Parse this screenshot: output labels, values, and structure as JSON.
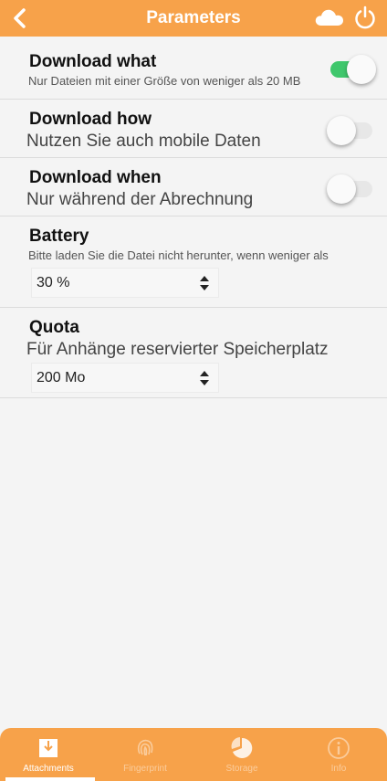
{
  "header": {
    "title": "Parameters",
    "back_icon": "chevron-left-icon",
    "cloud_icon": "cloud-icon",
    "power_icon": "power-icon",
    "color": "#f7a24a"
  },
  "settings": {
    "download_what": {
      "title": "Download what",
      "subtitle": "Nur Dateien mit einer Größe von weniger als 20 MB",
      "enabled": true
    },
    "download_how": {
      "title": "Download how",
      "subtitle": "Nutzen Sie auch mobile Daten",
      "enabled": false
    },
    "download_when": {
      "title": "Download when",
      "subtitle": "Nur während der Abrechnung",
      "enabled": false
    },
    "battery": {
      "title": "Battery",
      "subtitle": "Bitte laden Sie die Datei nicht herunter, wenn weniger als",
      "selected": "30 %"
    },
    "quota": {
      "title": "Quota",
      "subtitle": "Für Anhänge reservierter Speicherplatz",
      "selected": "200 Mo"
    }
  },
  "tabbar": {
    "tabs": [
      {
        "label": "Attachments",
        "icon": "download-tray-icon",
        "active": true
      },
      {
        "label": "Fingerprint",
        "icon": "fingerprint-icon",
        "active": false
      },
      {
        "label": "Storage",
        "icon": "pie-chart-icon",
        "active": false
      },
      {
        "label": "Info",
        "icon": "info-icon",
        "active": false
      }
    ]
  },
  "colors": {
    "accent": "#f7a24a",
    "toggle_on": "#3fc76c"
  }
}
